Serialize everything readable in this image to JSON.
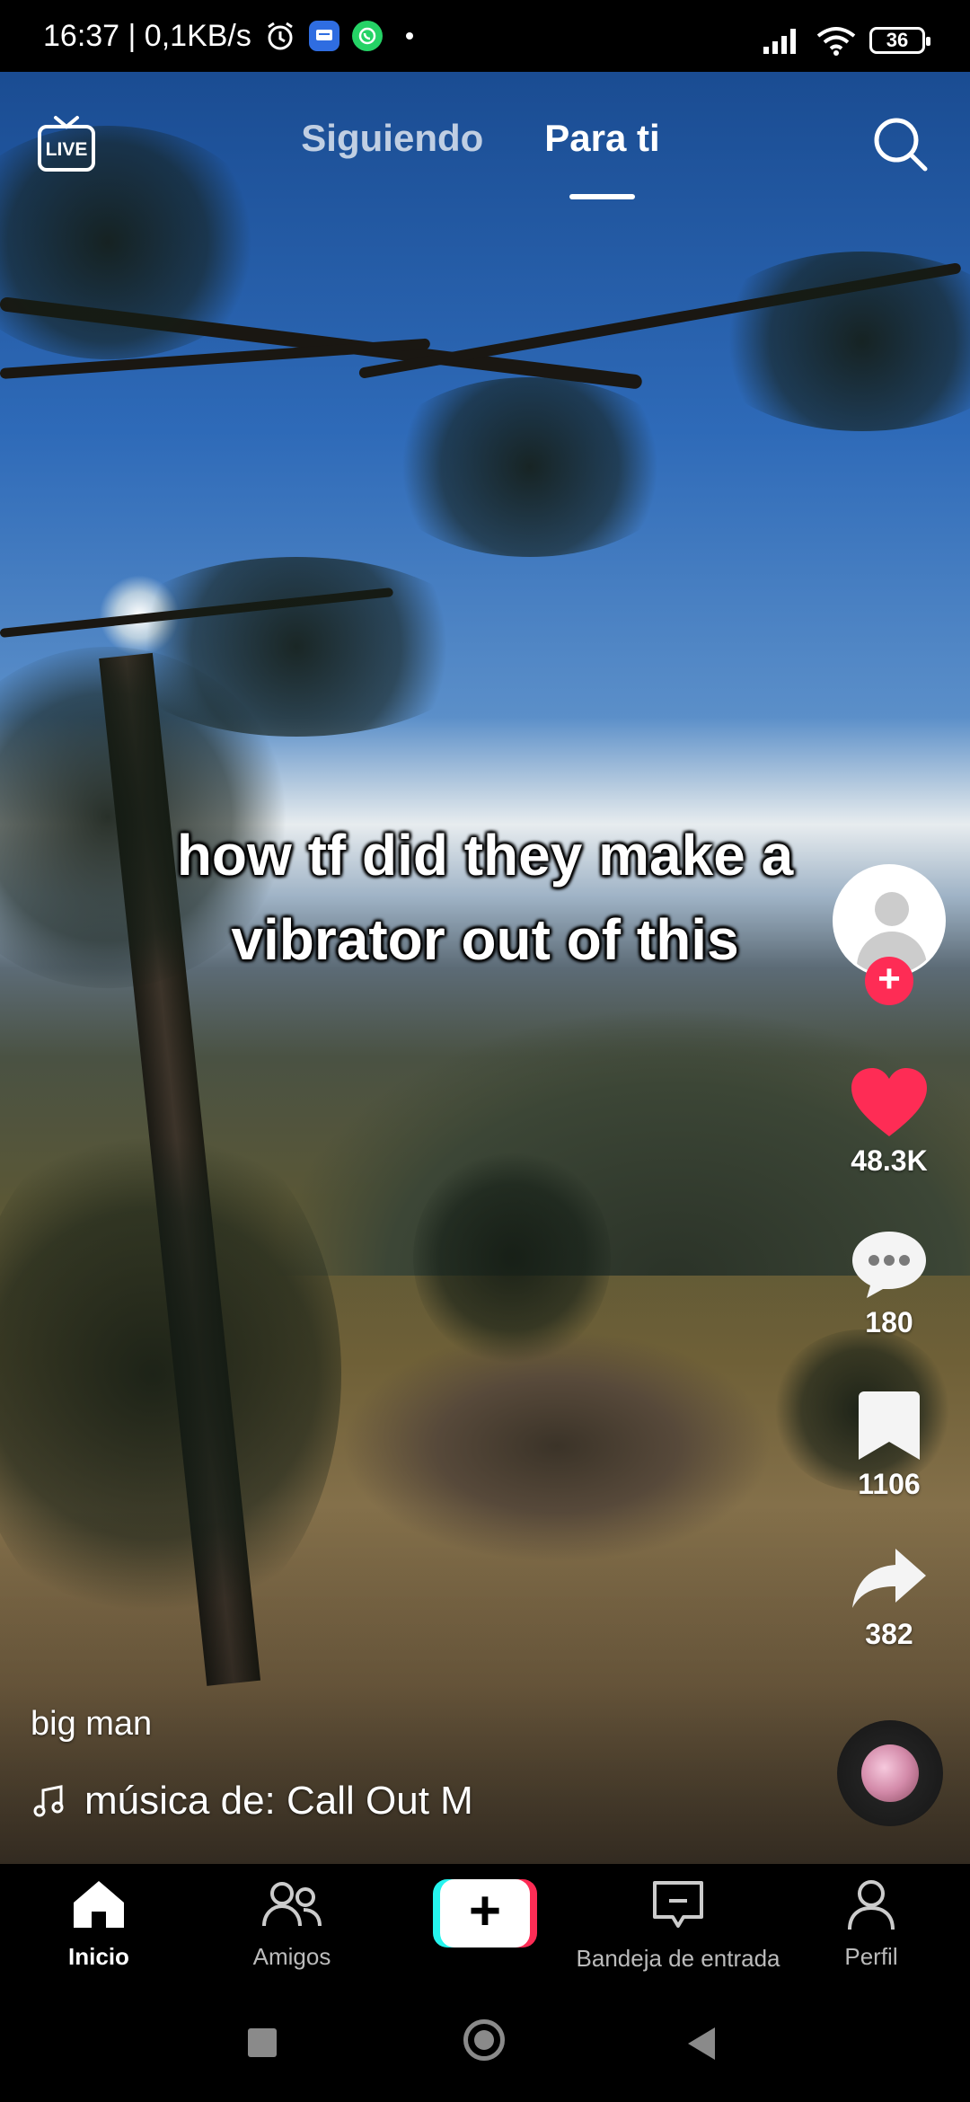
{
  "status_bar": {
    "left_text": "16:37 | 0,1KB/s",
    "battery": "36"
  },
  "top_nav": {
    "live_label": "LIVE",
    "tabs": [
      {
        "label": "Siguiendo",
        "active": false
      },
      {
        "label": "Para ti",
        "active": true
      }
    ]
  },
  "video": {
    "caption_line1": "how tf did they make a",
    "caption_line2": "vibrator out of this",
    "username": "big man",
    "music": "música de: Call Out M"
  },
  "actions": {
    "likes": "48.3K",
    "comments": "180",
    "bookmarks": "1106",
    "shares": "382"
  },
  "bottom_nav": {
    "home": "Inicio",
    "friends": "Amigos",
    "create": "+",
    "inbox": "Bandeja de entrada",
    "profile": "Perfil"
  },
  "colors": {
    "accent_red": "#fe2c55",
    "accent_cyan": "#25f4ee",
    "nav_bg": "#000000"
  }
}
